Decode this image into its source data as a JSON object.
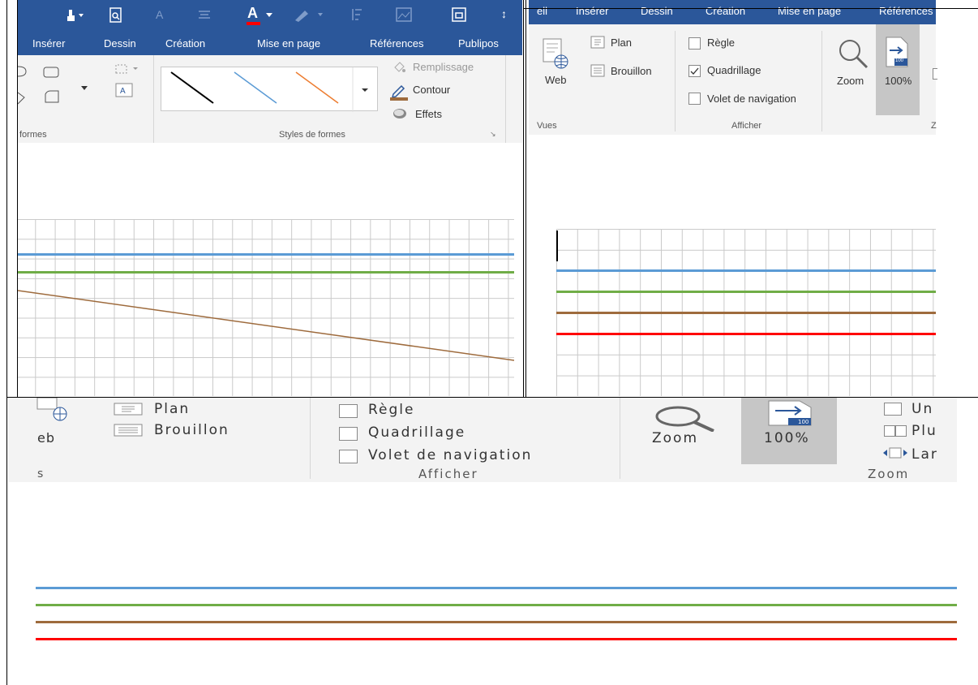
{
  "colors": {
    "ribbon": "#2b579a",
    "blue": "#5b9bd5",
    "green": "#70ad47",
    "brown": "#9e6b3d",
    "red": "#ff0000",
    "orange": "#ed7d31"
  },
  "panel1": {
    "tabs": [
      "Insérer",
      "Dessin",
      "Création",
      "Mise en page",
      "Références",
      "Publipos"
    ],
    "fill_label": "Remplissage",
    "outline_label": "Contour",
    "effects_label": "Effets",
    "group_shapes": "formes",
    "group_styles": "Styles de formes"
  },
  "panel2": {
    "tabs": [
      "ell",
      "Insérer",
      "Dessin",
      "Création",
      "Mise en page",
      "Références"
    ],
    "views": {
      "web": "Web",
      "plan": "Plan",
      "draft": "Brouillon",
      "group": "Vues"
    },
    "show": {
      "ruler": "Règle",
      "gridlines": "Quadrillage",
      "nav": "Volet de navigation",
      "group": "Afficher",
      "gridlines_checked": true
    },
    "zoom": {
      "zoom": "Zoom",
      "percent": "100%",
      "badge": "100",
      "group_partial": "Z"
    }
  },
  "panel3": {
    "views": {
      "web": "eb",
      "plan": "Plan",
      "draft": "Brouillon",
      "group": "s"
    },
    "show": {
      "ruler": "Règle",
      "gridlines": "Quadrillage",
      "nav": "Volet de navigation",
      "group": "Afficher"
    },
    "zoom": {
      "zoom": "Zoom",
      "percent": "100%",
      "badge": "100",
      "one": "Un",
      "many": "Plu",
      "width": "Lar",
      "group": "Zoom"
    }
  }
}
